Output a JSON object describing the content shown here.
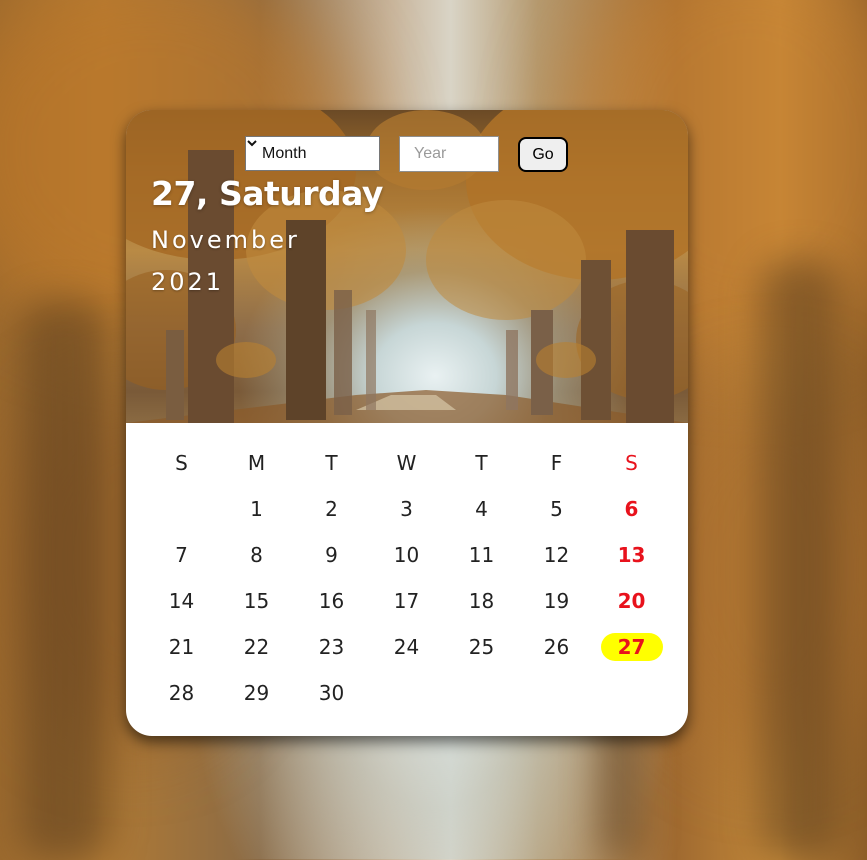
{
  "header": {
    "month_select_value": "Month",
    "year_placeholder": "Year",
    "go_label": "Go",
    "date_line": "27, Saturday",
    "month_line": "November",
    "year_line": "2021"
  },
  "calendar": {
    "weekdays": [
      "S",
      "M",
      "T",
      "W",
      "T",
      "F",
      "S"
    ],
    "weeks": [
      [
        "",
        "1",
        "2",
        "3",
        "4",
        "5",
        "6"
      ],
      [
        "7",
        "8",
        "9",
        "10",
        "11",
        "12",
        "13"
      ],
      [
        "14",
        "15",
        "16",
        "17",
        "18",
        "19",
        "20"
      ],
      [
        "21",
        "22",
        "23",
        "24",
        "25",
        "26",
        "27"
      ],
      [
        "28",
        "29",
        "30",
        "",
        "",
        "",
        ""
      ]
    ],
    "today": "27",
    "colors": {
      "weekend": "#e8121c",
      "today_highlight": "#ffff00"
    }
  }
}
